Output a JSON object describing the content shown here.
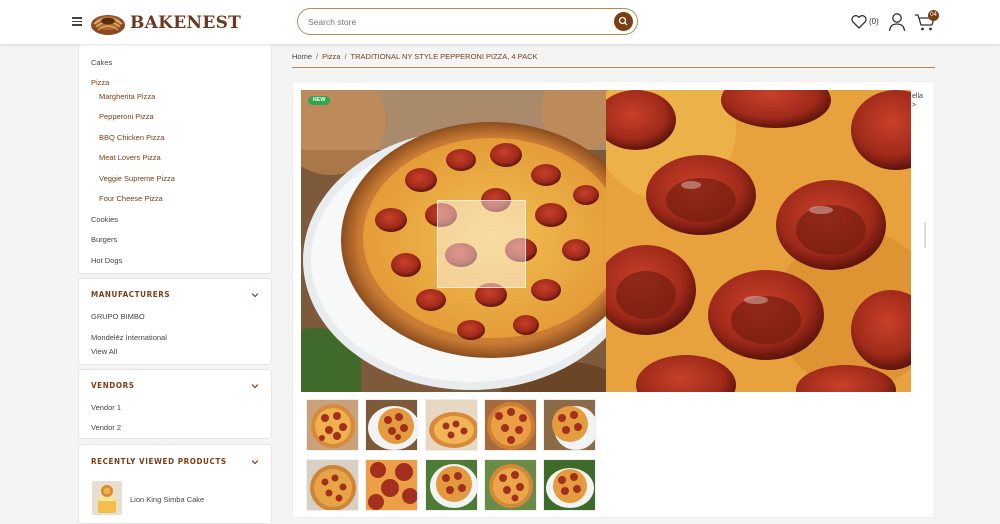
{
  "header": {
    "brand": "BAKENEST",
    "search": {
      "placeholder": "Search store"
    },
    "wishlist_count": "(0)",
    "cart_count": "04"
  },
  "sidebar": {
    "categories": {
      "top_item": "Cakes",
      "active_item": "Pizza",
      "sub_items": [
        "Margherita Pizza",
        "Pepperoni Pizza",
        "BBQ Chicken Pizza",
        "Meat Lovers Pizza",
        "Veggie Supreme Pizza",
        "Four Cheese Pizza"
      ],
      "other_items": [
        "Cookies",
        "Burgers",
        "Hot Dogs"
      ]
    },
    "manufacturers": {
      "title": "MANUFACTURERS",
      "items": [
        "GRUPO BIMBO",
        "Mondelēz International"
      ],
      "view_all": "View All"
    },
    "vendors": {
      "title": "VENDORS",
      "items": [
        "Vendor 1",
        "Vendor 2"
      ]
    },
    "recently_viewed": {
      "title": "RECENTLY VIEWED PRODUCTS",
      "items": [
        "Lion King Simba Cake"
      ]
    }
  },
  "breadcrumb": {
    "home": "Home",
    "category": "Pizza",
    "current": "TRADITIONAL NY STYLE PEPPERONI PIZZA, 4 PACK",
    "separator": "/"
  },
  "product": {
    "badge": "NEW",
    "peek_text": "ella\n>"
  },
  "colors": {
    "brand": "#7a3e14",
    "accent_line": "#b58a5a",
    "new_badge": "#2ea84a"
  },
  "icons": {
    "menu": "hamburger-icon",
    "search": "search-icon",
    "wishlist": "heart-icon",
    "account": "user-icon",
    "cart": "cart-icon",
    "expand": "chevron-down-icon"
  }
}
